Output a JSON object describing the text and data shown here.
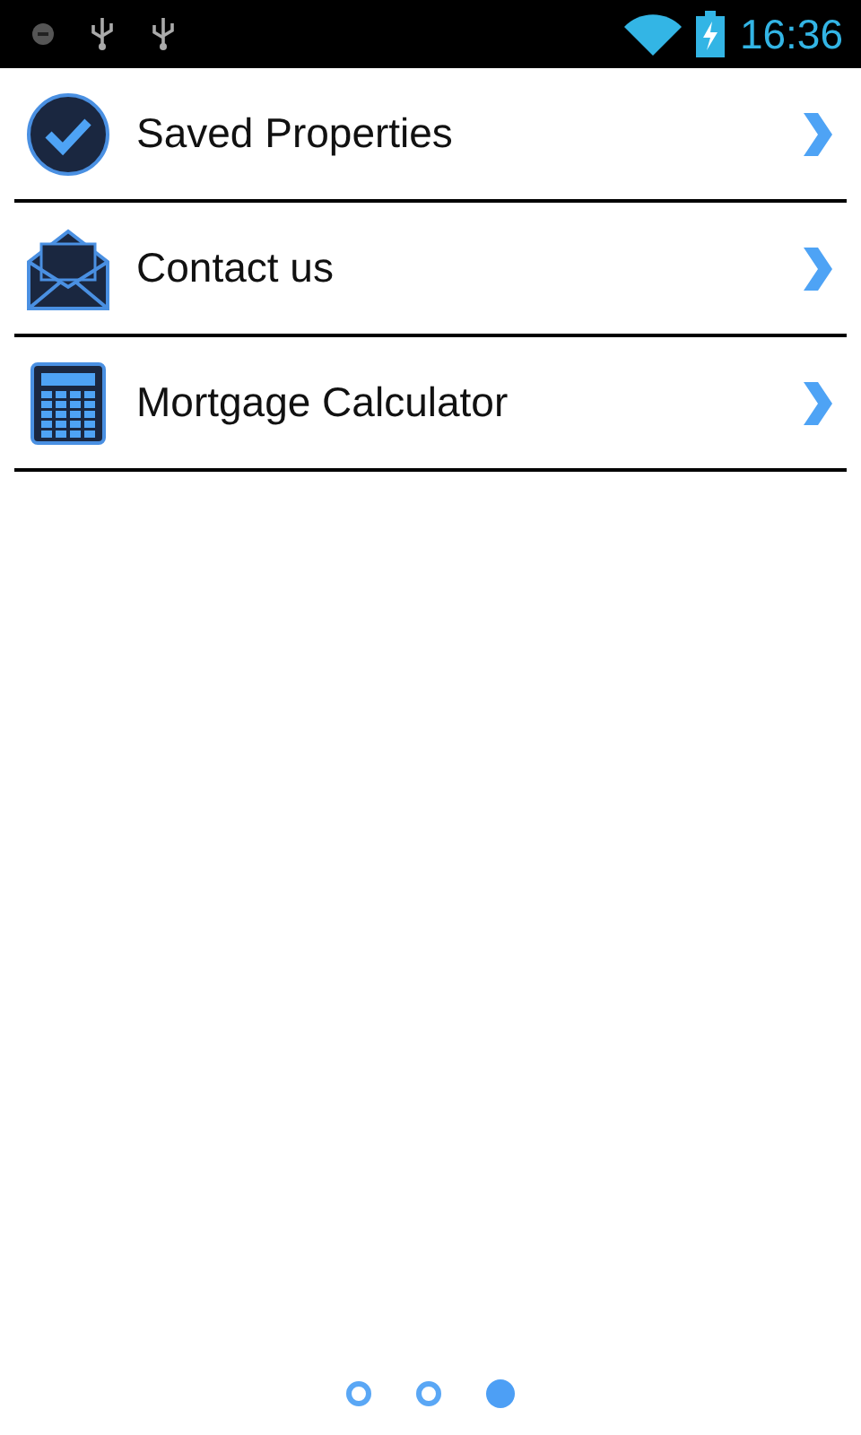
{
  "status_bar": {
    "time": "16:36"
  },
  "menu": [
    {
      "kind": "check",
      "label": "Saved Properties"
    },
    {
      "kind": "mail",
      "label": "Contact us"
    },
    {
      "kind": "calculator",
      "label": "Mortgage Calculator"
    }
  ],
  "pager": [
    {
      "selected": false
    },
    {
      "selected": false
    },
    {
      "selected": true
    }
  ]
}
